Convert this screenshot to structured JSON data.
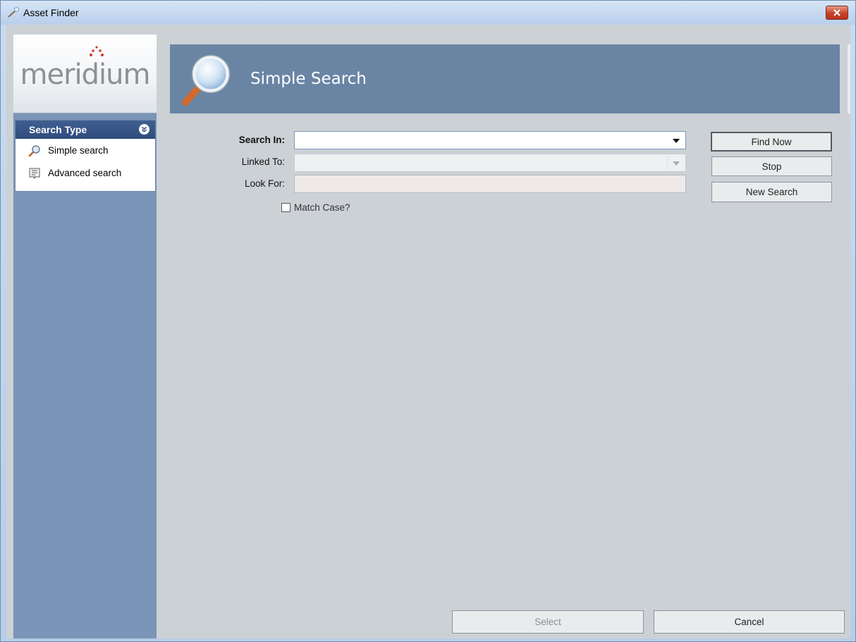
{
  "window": {
    "title": "Asset Finder"
  },
  "logo": {
    "text": "meridium"
  },
  "sidebar": {
    "panel_title": "Search Type",
    "items": [
      {
        "label": "Simple search",
        "icon": "magnifier-icon"
      },
      {
        "label": "Advanced search",
        "icon": "advanced-search-icon"
      }
    ]
  },
  "header": {
    "title": "Simple Search"
  },
  "form": {
    "search_in_label": "Search In:",
    "search_in_value": "",
    "linked_to_label": "Linked To:",
    "linked_to_value": "",
    "look_for_label": "Look For:",
    "look_for_value": "",
    "match_case_label": "Match Case?",
    "match_case_checked": false
  },
  "actions": {
    "find_now": "Find Now",
    "stop": "Stop",
    "new_search": "New Search"
  },
  "footer": {
    "select": "Select",
    "cancel": "Cancel"
  },
  "colors": {
    "banner": "#6a85a4",
    "sidebar": "#7a95b7",
    "panel_header": "#2f4c7c",
    "client_bg": "#ccd1d6",
    "close_button": "#c8412b"
  }
}
